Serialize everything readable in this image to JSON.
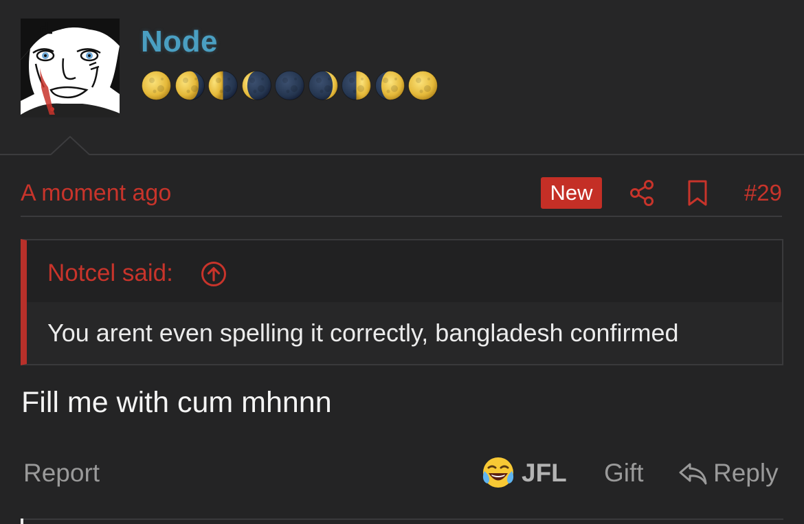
{
  "author": {
    "username": "Node",
    "avatar_icon": "avatar-icon",
    "username_color": "#4a9fc2",
    "moon_icons": [
      {
        "name": "full-moon-icon",
        "phase": "full"
      },
      {
        "name": "waning-gibbous-moon-icon",
        "phase": "waning-gibbous"
      },
      {
        "name": "last-quarter-moon-icon",
        "phase": "last-quarter"
      },
      {
        "name": "waning-crescent-moon-icon",
        "phase": "waning-crescent"
      },
      {
        "name": "new-moon-icon",
        "phase": "new"
      },
      {
        "name": "waxing-crescent-moon-icon",
        "phase": "waxing-crescent"
      },
      {
        "name": "first-quarter-moon-icon",
        "phase": "first-quarter"
      },
      {
        "name": "waxing-gibbous-moon-icon",
        "phase": "waxing-gibbous"
      },
      {
        "name": "full-moon-icon",
        "phase": "full"
      }
    ]
  },
  "meta": {
    "timestamp": "A moment ago",
    "new_badge": "New",
    "post_number": "#29",
    "share_icon": "share-icon",
    "bookmark_icon": "bookmark-icon"
  },
  "quote": {
    "author_line": "Notcel said:",
    "expand_icon": "arrow-up-circle-icon",
    "text": "You arent even spelling it correctly, bangladesh confirmed"
  },
  "post": {
    "body": "Fill me with cum mhnnn"
  },
  "actions": {
    "report": "Report",
    "reaction_icon": "crying-laughing-emoji-icon",
    "reaction_label": "JFL",
    "gift": "Gift",
    "reply_icon": "reply-arrow-icon",
    "reply": "Reply"
  },
  "colors": {
    "background": "#242425",
    "accent_red": "#c8342b",
    "badge_red": "#c42f26",
    "quote_bar": "#b8302a"
  }
}
